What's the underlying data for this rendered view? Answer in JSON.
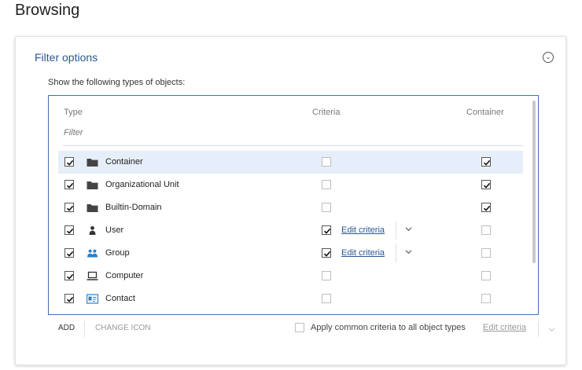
{
  "page": {
    "title": "Browsing"
  },
  "filter_options": {
    "title": "Filter options",
    "subtitle": "Show the following types of objects:",
    "columns": {
      "type": "Type",
      "criteria": "Criteria",
      "container": "Container"
    },
    "filter_placeholder": "Filter",
    "rows": [
      {
        "label": "Container",
        "icon": "folder-icon",
        "shown": true,
        "criteria": false,
        "edit_criteria": "",
        "container": true,
        "selected": true
      },
      {
        "label": "Organizational Unit",
        "icon": "folder-icon",
        "shown": true,
        "criteria": false,
        "edit_criteria": "",
        "container": true,
        "selected": false
      },
      {
        "label": "Builtin-Domain",
        "icon": "folder-icon",
        "shown": true,
        "criteria": false,
        "edit_criteria": "",
        "container": true,
        "selected": false
      },
      {
        "label": "User",
        "icon": "user-icon",
        "shown": true,
        "criteria": true,
        "edit_criteria": "Edit criteria",
        "container": false,
        "selected": false
      },
      {
        "label": "Group",
        "icon": "group-icon",
        "shown": true,
        "criteria": true,
        "edit_criteria": "Edit criteria",
        "container": false,
        "selected": false
      },
      {
        "label": "Computer",
        "icon": "computer-icon",
        "shown": true,
        "criteria": false,
        "edit_criteria": "",
        "container": false,
        "selected": false
      },
      {
        "label": "Contact",
        "icon": "contact-card-icon",
        "shown": true,
        "criteria": false,
        "edit_criteria": "",
        "container": false,
        "selected": false
      }
    ],
    "footer": {
      "add_label": "ADD",
      "change_icon_label": "CHANGE ICON",
      "apply_label": "Apply common criteria to all object types",
      "apply_checked": false,
      "edit_criteria_label": "Edit criteria"
    }
  },
  "colors": {
    "accent": "#2b5797",
    "selected_row": "#e6eef9",
    "list_border": "#3f72af",
    "group_icon": "#2d7ec4"
  }
}
